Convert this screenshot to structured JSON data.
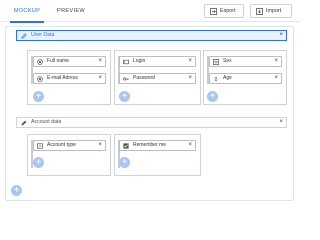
{
  "tabs": [
    {
      "label": "MOCKUP",
      "active": true
    },
    {
      "label": "PREVIEW",
      "active": false
    }
  ],
  "toolbar": {
    "export_label": "Export",
    "import_label": "Import"
  },
  "groups": [
    {
      "label": "User Data",
      "selected": true,
      "columns": [
        {
          "fields": [
            {
              "label": "Full name",
              "icon": "radio-icon"
            },
            {
              "label": "E-mail Adress",
              "icon": "radio-icon"
            }
          ]
        },
        {
          "fields": [
            {
              "label": "Login",
              "icon": "textbox-icon"
            },
            {
              "label": "Password",
              "icon": "key-icon"
            }
          ]
        },
        {
          "fields": [
            {
              "label": "Sex",
              "icon": "list-icon"
            },
            {
              "label": "Age",
              "icon": "stepper-icon"
            }
          ]
        }
      ]
    },
    {
      "label": "Account data",
      "selected": false,
      "columns": [
        {
          "fields": [
            {
              "label": "Account type",
              "icon": "select-icon"
            }
          ]
        },
        {
          "fields": [
            {
              "label": "Remember me",
              "icon": "checkbox-icon"
            }
          ]
        }
      ]
    }
  ],
  "close_glyph": "×",
  "add_glyph": "+",
  "colors": {
    "accent": "#2f73d9",
    "add_button": "#aac4f4",
    "selected_bg": "#eaf2ff"
  }
}
